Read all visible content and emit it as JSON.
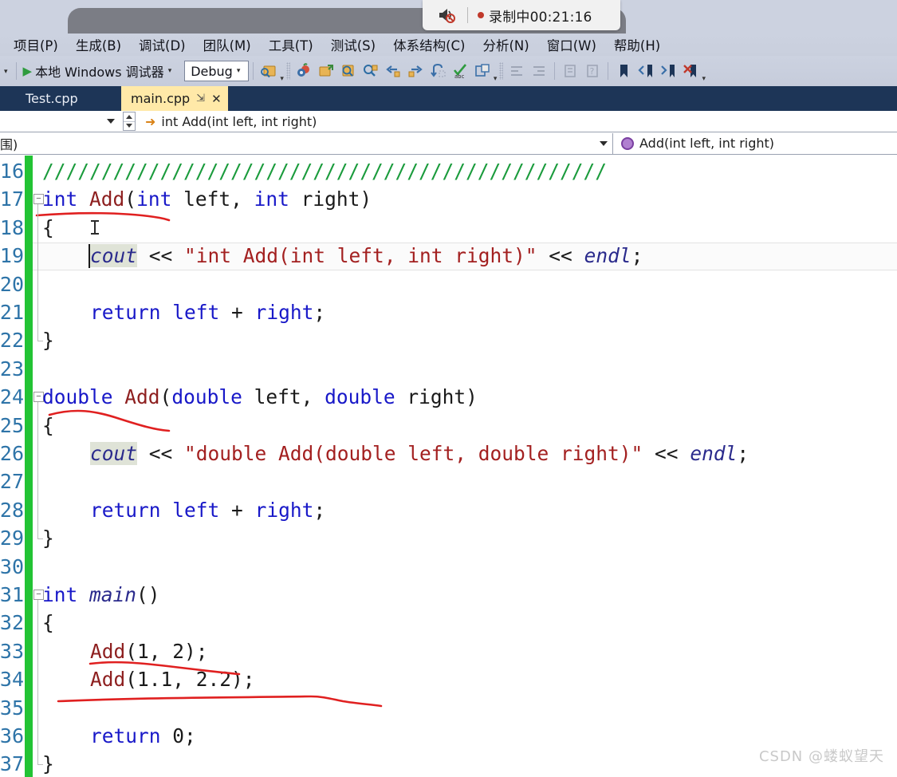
{
  "recording": {
    "speaker_icon": "speaker-muted-icon",
    "status_text": "录制中00:21:16"
  },
  "menubar": {
    "items": [
      {
        "label": "项目(P)"
      },
      {
        "label": "生成(B)"
      },
      {
        "label": "调试(D)"
      },
      {
        "label": "团队(M)"
      },
      {
        "label": "工具(T)"
      },
      {
        "label": "测试(S)"
      },
      {
        "label": "体系结构(C)"
      },
      {
        "label": "分析(N)"
      },
      {
        "label": "窗口(W)"
      },
      {
        "label": "帮助(H)"
      }
    ]
  },
  "toolbar": {
    "debug_start_label": "本地 Windows 调试器",
    "config_value": "Debug",
    "icons": [
      "search-scope-icon",
      "settings-apple-icon",
      "step-into-file-icon",
      "find-in-files-icon",
      "quick-find-icon",
      "step-back-icon",
      "step-forward-icon",
      "undo-step-icon",
      "spell-check-abc-icon",
      "copy-window-icon",
      "indent-left-icon",
      "indent-right-icon",
      "comment-icon",
      "uncomment-icon",
      "bookmark-icon",
      "prev-bookmark-icon",
      "next-bookmark-icon",
      "clear-bookmarks-icon"
    ]
  },
  "tabs": [
    {
      "label": "Test.cpp",
      "active": false
    },
    {
      "label": "main.cpp",
      "active": true,
      "pin_icon": "pin-icon",
      "close_icon": "close-icon"
    }
  ],
  "navbar_top": {
    "member_icon": "member-arrow-icon",
    "member_text": "int Add(int left, int right)"
  },
  "navbar_bottom": {
    "scope_text": "围)",
    "method_icon": "method-icon",
    "method_text": "Add(int left, int right)"
  },
  "editor": {
    "first_line_number": 16,
    "lines": [
      {
        "n": 16,
        "indent": 0,
        "tokens": [
          {
            "t": "////////////////////////////////////////////////",
            "c": "cmt"
          }
        ]
      },
      {
        "n": 17,
        "indent": 0,
        "fold": "collapse",
        "tokens": [
          {
            "t": "int",
            "c": "k"
          },
          {
            "t": " ",
            "c": "plain"
          },
          {
            "t": "Add",
            "c": "fn"
          },
          {
            "t": "(",
            "c": "plain"
          },
          {
            "t": "int",
            "c": "k"
          },
          {
            "t": " left, ",
            "c": "plain"
          },
          {
            "t": "int",
            "c": "k"
          },
          {
            "t": " right)",
            "c": "plain"
          }
        ]
      },
      {
        "n": 18,
        "indent": 0,
        "tokens": [
          {
            "t": "{",
            "c": "plain"
          }
        ]
      },
      {
        "n": 19,
        "indent": 1,
        "highlight": true,
        "tokens": [
          {
            "t": "cout",
            "c": "id",
            "bg": true
          },
          {
            "t": " << ",
            "c": "plain"
          },
          {
            "t": "\"int Add(int left, int right)\"",
            "c": "str"
          },
          {
            "t": " << ",
            "c": "plain"
          },
          {
            "t": "endl",
            "c": "id"
          },
          {
            "t": ";",
            "c": "plain"
          }
        ]
      },
      {
        "n": 20,
        "indent": 0,
        "tokens": []
      },
      {
        "n": 21,
        "indent": 1,
        "tokens": [
          {
            "t": "return",
            "c": "k"
          },
          {
            "t": " ",
            "c": "plain"
          },
          {
            "t": "left",
            "c": "k"
          },
          {
            "t": " + ",
            "c": "plain"
          },
          {
            "t": "right",
            "c": "k"
          },
          {
            "t": ";",
            "c": "plain"
          }
        ]
      },
      {
        "n": 22,
        "indent": 0,
        "tokens": [
          {
            "t": "}",
            "c": "plain"
          }
        ]
      },
      {
        "n": 23,
        "indent": 0,
        "tokens": []
      },
      {
        "n": 24,
        "indent": 0,
        "fold": "collapse",
        "tokens": [
          {
            "t": "double",
            "c": "k"
          },
          {
            "t": " ",
            "c": "plain"
          },
          {
            "t": "Add",
            "c": "fn"
          },
          {
            "t": "(",
            "c": "plain"
          },
          {
            "t": "double",
            "c": "k"
          },
          {
            "t": " left, ",
            "c": "plain"
          },
          {
            "t": "double",
            "c": "k"
          },
          {
            "t": " right)",
            "c": "plain"
          }
        ]
      },
      {
        "n": 25,
        "indent": 0,
        "tokens": [
          {
            "t": "{",
            "c": "plain"
          }
        ]
      },
      {
        "n": 26,
        "indent": 1,
        "tokens": [
          {
            "t": "cout",
            "c": "id",
            "bg": true
          },
          {
            "t": " << ",
            "c": "plain"
          },
          {
            "t": "\"double Add(double left, double right)\"",
            "c": "str"
          },
          {
            "t": " << ",
            "c": "plain"
          },
          {
            "t": "endl",
            "c": "id"
          },
          {
            "t": ";",
            "c": "plain"
          }
        ]
      },
      {
        "n": 27,
        "indent": 0,
        "tokens": []
      },
      {
        "n": 28,
        "indent": 1,
        "tokens": [
          {
            "t": "return",
            "c": "k"
          },
          {
            "t": " ",
            "c": "plain"
          },
          {
            "t": "left",
            "c": "k"
          },
          {
            "t": " + ",
            "c": "plain"
          },
          {
            "t": "right",
            "c": "k"
          },
          {
            "t": ";",
            "c": "plain"
          }
        ]
      },
      {
        "n": 29,
        "indent": 0,
        "tokens": [
          {
            "t": "}",
            "c": "plain"
          }
        ]
      },
      {
        "n": 30,
        "indent": 0,
        "tokens": []
      },
      {
        "n": 31,
        "indent": 0,
        "fold": "collapse",
        "tokens": [
          {
            "t": "int",
            "c": "k"
          },
          {
            "t": " ",
            "c": "plain"
          },
          {
            "t": "main",
            "c": "id"
          },
          {
            "t": "()",
            "c": "plain"
          }
        ]
      },
      {
        "n": 32,
        "indent": 0,
        "tokens": [
          {
            "t": "{",
            "c": "plain"
          }
        ]
      },
      {
        "n": 33,
        "indent": 1,
        "tokens": [
          {
            "t": "Add",
            "c": "fn"
          },
          {
            "t": "(1, 2);",
            "c": "plain"
          }
        ]
      },
      {
        "n": 34,
        "indent": 1,
        "tokens": [
          {
            "t": "Add",
            "c": "fn"
          },
          {
            "t": "(1.1, 2.2);",
            "c": "plain"
          }
        ]
      },
      {
        "n": 35,
        "indent": 0,
        "tokens": []
      },
      {
        "n": 36,
        "indent": 1,
        "tokens": [
          {
            "t": "return",
            "c": "k"
          },
          {
            "t": " ",
            "c": "plain"
          },
          {
            "t": "0",
            "c": "plain"
          },
          {
            "t": ";",
            "c": "plain"
          }
        ]
      },
      {
        "n": 37,
        "indent": 0,
        "tokens": [
          {
            "t": "}",
            "c": "plain"
          }
        ]
      }
    ]
  },
  "colors": {
    "change_bar": "#22c334",
    "keyword": "#1818c8",
    "function": "#8e2020",
    "string": "#a32020",
    "comment": "#1a9b3c",
    "identifier": "#2a2a8c",
    "line_number": "#2e74a8",
    "tab_active_bg": "#ffe9a8",
    "tabstrip_bg": "#1d3557",
    "annotation_red": "#e02020"
  },
  "watermark": {
    "text": "CSDN @蝼蚁望天"
  }
}
